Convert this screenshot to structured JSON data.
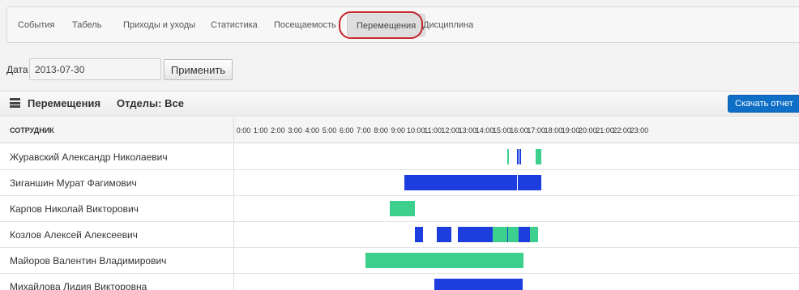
{
  "tabs": [
    {
      "label": "События",
      "active": false
    },
    {
      "label": "Табель",
      "active": false
    },
    {
      "label": "Приходы и уходы",
      "active": false
    },
    {
      "label": "Статистика",
      "active": false
    },
    {
      "label": "Посещаемость",
      "active": false
    },
    {
      "label": "Перемещения",
      "active": true
    },
    {
      "label": "Дисциплина",
      "active": false
    }
  ],
  "date_filter": {
    "label": "Дата",
    "value": "2013-07-30",
    "apply_label": "Применить"
  },
  "panel": {
    "title": "Перемещения",
    "departments": "Отделы: Все",
    "download_label": "Скачать отчет"
  },
  "table": {
    "employee_header": "СОТРУДНИК",
    "hours": [
      "0:00",
      "1:00",
      "2:00",
      "3:00",
      "4:00",
      "5:00",
      "6:00",
      "7:00",
      "8:00",
      "9:00",
      "10:00",
      "11:00",
      "12:00",
      "13:00",
      "14:00",
      "15:00",
      "16:00",
      "17:00",
      "18:00",
      "19:00",
      "20:00",
      "21:00",
      "22:00",
      "23:00"
    ],
    "rows": [
      {
        "name": "Журавский Александр Николаевич",
        "segments": [
          {
            "start": 15.85,
            "end": 15.92,
            "status": "green"
          },
          {
            "start": 16.4,
            "end": 16.44,
            "status": "blue"
          },
          {
            "start": 16.55,
            "end": 16.6,
            "status": "blue"
          },
          {
            "start": 17.5,
            "end": 17.82,
            "status": "green"
          }
        ]
      },
      {
        "name": "Зиганшин Мурат Фагимович",
        "segments": [
          {
            "start": 9.85,
            "end": 16.4,
            "status": "blue"
          },
          {
            "start": 16.45,
            "end": 17.85,
            "status": "blue"
          }
        ]
      },
      {
        "name": "Карпов Николай Викторович",
        "segments": [
          {
            "start": 9.0,
            "end": 10.45,
            "status": "green"
          }
        ]
      },
      {
        "name": "Козлов Алексей Алексеевич",
        "segments": [
          {
            "start": 10.45,
            "end": 10.5,
            "status": "blue"
          },
          {
            "start": 10.55,
            "end": 10.95,
            "status": "blue"
          },
          {
            "start": 11.75,
            "end": 12.6,
            "status": "blue"
          },
          {
            "start": 12.95,
            "end": 13.0,
            "status": "blue"
          },
          {
            "start": 13.05,
            "end": 14.98,
            "status": "blue"
          },
          {
            "start": 14.98,
            "end": 15.85,
            "status": "green"
          },
          {
            "start": 15.85,
            "end": 15.9,
            "status": "blue"
          },
          {
            "start": 15.9,
            "end": 16.5,
            "status": "green"
          },
          {
            "start": 16.5,
            "end": 17.15,
            "status": "blue"
          },
          {
            "start": 17.15,
            "end": 17.65,
            "status": "green"
          }
        ]
      },
      {
        "name": "Майоров Валентин Владимирович",
        "segments": [
          {
            "start": 7.6,
            "end": 16.8,
            "status": "green"
          }
        ]
      },
      {
        "name": "Михайлова Лидия Викторовна",
        "segments": [
          {
            "start": 11.6,
            "end": 16.75,
            "status": "blue"
          }
        ]
      }
    ]
  }
}
